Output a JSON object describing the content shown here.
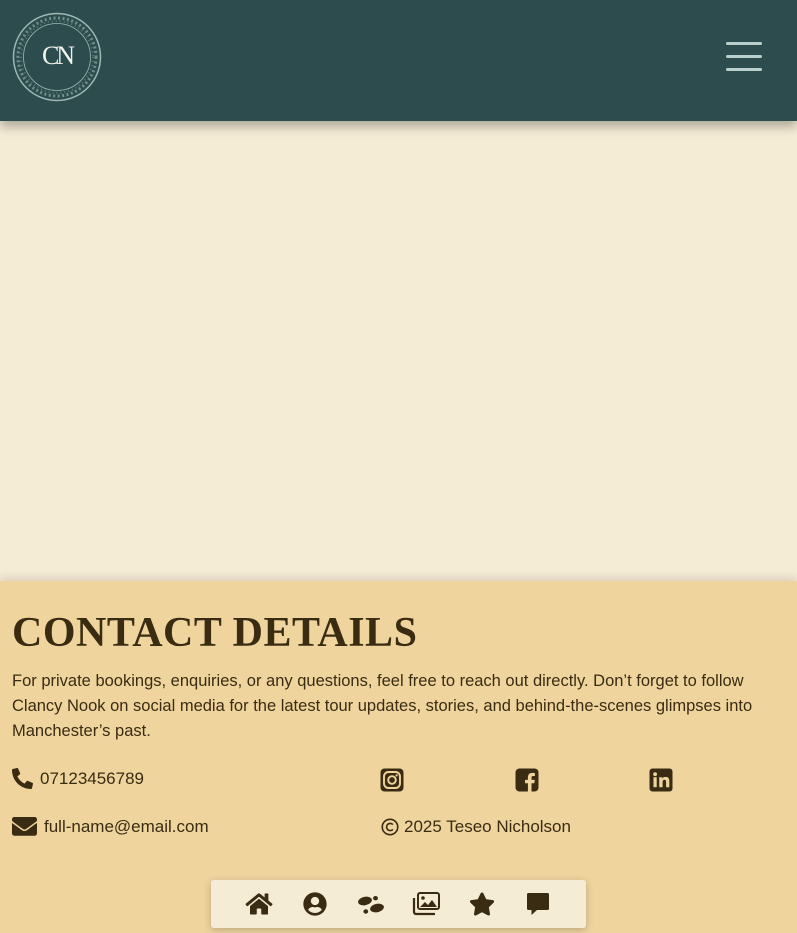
{
  "header": {
    "logo_text": "CN",
    "menu_icon": "hamburger-menu-icon"
  },
  "footer": {
    "title": "CONTACT DETAILS",
    "description": "For private bookings, enquiries, or any questions, feel free to reach out directly. Don’t forget to follow Clancy Nook on social media for the latest tour updates, stories, and behind-the-scenes glimpses into Manchester’s past.",
    "phone": "07123456789",
    "email": "full-name@email.com",
    "copyright": "2025 Teseo Nicholson",
    "social": [
      {
        "name": "instagram",
        "icon": "instagram-icon"
      },
      {
        "name": "facebook",
        "icon": "facebook-icon"
      },
      {
        "name": "linkedin",
        "icon": "linkedin-icon"
      }
    ]
  },
  "bottom_nav": {
    "items": [
      {
        "icon": "home-icon"
      },
      {
        "icon": "user-circle-icon"
      },
      {
        "icon": "footprints-icon"
      },
      {
        "icon": "images-icon"
      },
      {
        "icon": "star-icon"
      },
      {
        "icon": "comment-icon"
      }
    ]
  },
  "colors": {
    "header_bg": "#2d4c4e",
    "page_bg": "#f5ecd6",
    "footer_bg": "#efd49e",
    "text": "#3a2c12",
    "menu_lines": "#b9cfcb"
  }
}
